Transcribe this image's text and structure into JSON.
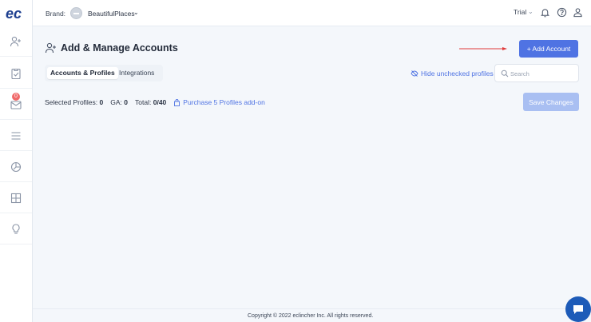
{
  "colors": {
    "accent": "#4f73e3",
    "accent_disabled": "#a9bff2",
    "badge": "#f06a6a",
    "arrow": "#e03a3a",
    "chat": "#1d5bb8"
  },
  "logo": {
    "text": "ec"
  },
  "sidebar": {
    "items": [
      {
        "name": "add-user-icon"
      },
      {
        "name": "clipboard-icon"
      },
      {
        "name": "inbox-icon",
        "badge": "0"
      },
      {
        "name": "menu-icon"
      },
      {
        "name": "analytics-icon"
      },
      {
        "name": "grid-icon"
      },
      {
        "name": "lightbulb-icon"
      }
    ]
  },
  "topbar": {
    "brand_label": "Brand:",
    "brand_name": "BeautifulPlaces",
    "plan": "Trial",
    "icons": [
      "bell-icon",
      "help-icon",
      "user-icon"
    ]
  },
  "page": {
    "title": "Add & Manage Accounts",
    "add_button": "+ Add Account",
    "tabs": [
      {
        "label": "Accounts & Profiles",
        "active": true
      },
      {
        "label": "Integrations",
        "active": false
      }
    ],
    "hide_link": "Hide unchecked profiles",
    "search_placeholder": "Search",
    "stats": {
      "selected_label": "Selected Profiles:",
      "selected_value": "0",
      "ga_label": "GA:",
      "ga_value": "0",
      "total_label": "Total:",
      "total_value": "0/40"
    },
    "purchase_link": "Purchase 5 Profiles add-on",
    "save_button": "Save Changes"
  },
  "footer": {
    "copyright": "Copyright © 2022 eclincher Inc. All rights reserved."
  }
}
